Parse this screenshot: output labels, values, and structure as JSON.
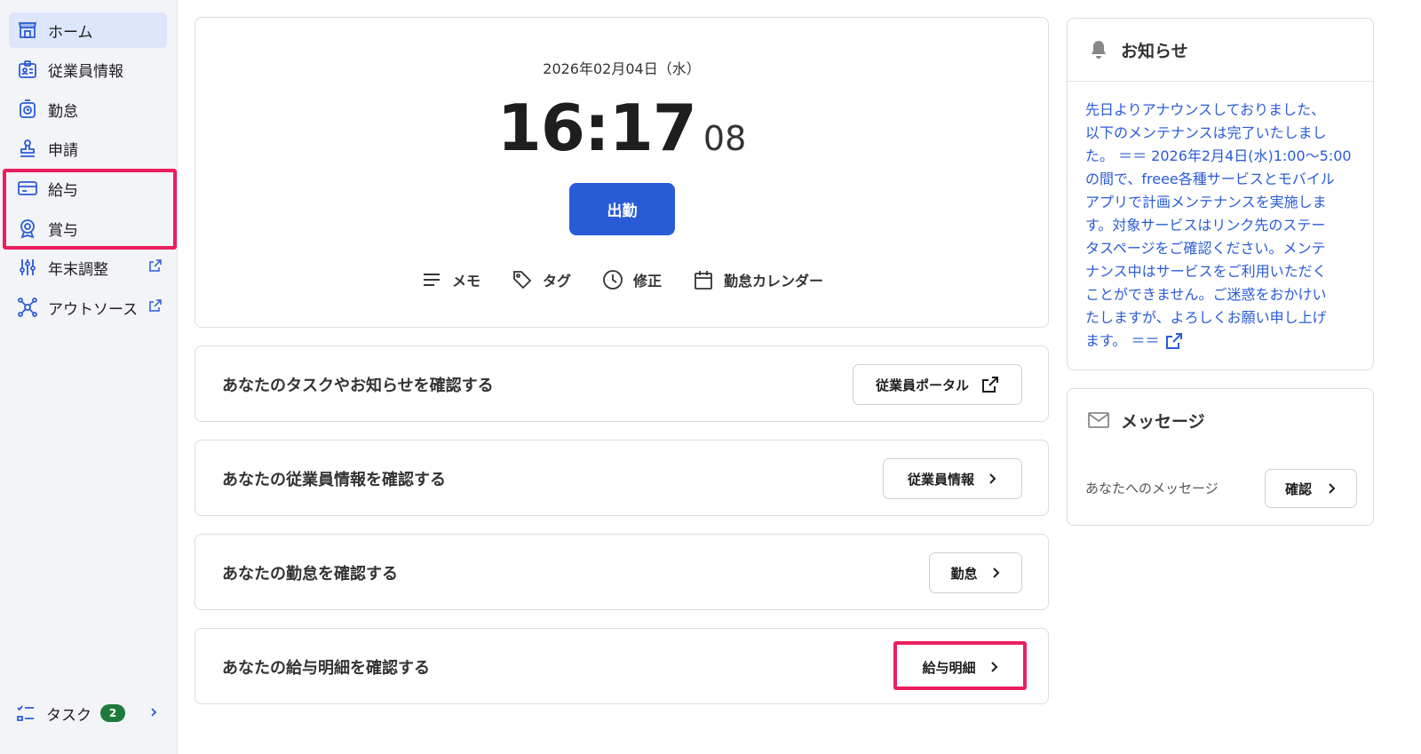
{
  "sidebar": {
    "items": [
      {
        "label": "ホーム",
        "icon": "store-icon"
      },
      {
        "label": "従業員情報",
        "icon": "id-card-icon"
      },
      {
        "label": "勤怠",
        "icon": "timer-icon"
      },
      {
        "label": "申請",
        "icon": "stamp-icon"
      },
      {
        "label": "給与",
        "icon": "card-icon"
      },
      {
        "label": "賞与",
        "icon": "award-icon"
      },
      {
        "label": "年末調整",
        "icon": "sliders-icon"
      },
      {
        "label": "アウトソース",
        "icon": "network-icon"
      }
    ],
    "task": {
      "label": "タスク",
      "count": "2"
    }
  },
  "clock": {
    "date": "2026年02月04日（水）",
    "time": "16:17",
    "seconds": "08",
    "clockin_label": "出勤",
    "actions": [
      {
        "label": "メモ",
        "icon": "lines-icon"
      },
      {
        "label": "タグ",
        "icon": "tag-icon"
      },
      {
        "label": "修正",
        "icon": "clock-icon"
      },
      {
        "label": "勤怠カレンダー",
        "icon": "calendar-icon"
      }
    ]
  },
  "rows": [
    {
      "text": "あなたのタスクやお知らせを確認する",
      "button": "従業員ポータル"
    },
    {
      "text": "あなたの従業員情報を確認する",
      "button": "従業員情報"
    },
    {
      "text": "あなたの勤怠を確認する",
      "button": "勤怠"
    },
    {
      "text": "あなたの給与明細を確認する",
      "button": "給与明細"
    }
  ],
  "notice": {
    "title": "お知らせ",
    "lines": [
      "先日よりアナウンスしておりました、",
      "以下のメンテナンスは完了いたしまし",
      "た。 ＝＝ 2026年2月4日(水)1:00～5:00",
      "の間で、freee各種サービスとモバイル",
      "アプリで計画メンテナンスを実施しま",
      "す。対象サービスはリンク先のステー",
      "タスページをご確認ください。メンテ",
      "ナンス中はサービスをご利用いただく",
      "ことができません。ご迷惑をおかけい",
      "たしますが、よろしくお願い申し上げ",
      "ます。 ＝＝"
    ]
  },
  "message": {
    "title": "メッセージ",
    "text": "あなたへのメッセージ",
    "button": "確認"
  },
  "colors": {
    "accent": "#2a5bd7",
    "highlight": "#ea1f5e",
    "badge": "#1f7a3d"
  }
}
